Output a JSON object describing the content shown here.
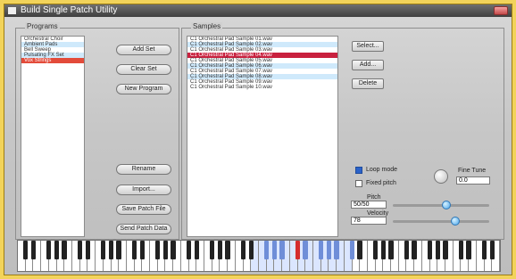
{
  "window": {
    "title": "Build Single Patch Utility"
  },
  "programs": {
    "label": "Programs",
    "items": [
      {
        "label": "Orchestral Choir",
        "style": "normal"
      },
      {
        "label": "Ambient Pads",
        "style": "alt"
      },
      {
        "label": "Bell Sweep",
        "style": "normal"
      },
      {
        "label": "Pulsating FX Set",
        "style": "alt"
      },
      {
        "label": "Vox Strings",
        "style": "sel"
      }
    ]
  },
  "program_buttons": {
    "add_set": "Add Set",
    "clear_set": "Clear Set",
    "new_program": "New Program",
    "rename": "Rename",
    "import": "Import...",
    "save_patch_file": "Save Patch File",
    "send_patch_data": "Send Patch Data"
  },
  "samples": {
    "label": "Samples",
    "items": [
      {
        "label": "C1 Orchestral Pad Sample 01.wav",
        "style": "normal"
      },
      {
        "label": "C1 Orchestral Pad Sample 02.wav",
        "style": "alt"
      },
      {
        "label": "C1 Orchestral Pad Sample 03.wav",
        "style": "normal"
      },
      {
        "label": "C1 Orchestral Pad Sample 04.wav",
        "style": "selhi"
      },
      {
        "label": "C1 Orchestral Pad Sample 05.wav",
        "style": "normal"
      },
      {
        "label": "C1 Orchestral Pad Sample 06.wav",
        "style": "alt"
      },
      {
        "label": "C1 Orchestral Pad Sample 07.wav",
        "style": "normal"
      },
      {
        "label": "C1 Orchestral Pad Sample 08.wav",
        "style": "alt"
      },
      {
        "label": "C1 Orchestral Pad Sample 09.wav",
        "style": "normal"
      },
      {
        "label": "C1 Orchestral Pad Sample 10.wav",
        "style": "normal"
      }
    ]
  },
  "sample_buttons": {
    "select": "Select...",
    "add": "Add...",
    "delete": "Delete"
  },
  "options": {
    "loop_mode_label": "Loop mode",
    "fixed_pitch_label": "Fixed pitch",
    "loop_mode_checked": true,
    "fixed_pitch_checked": false,
    "fine_tune_label": "Fine Tune",
    "fine_tune_value": "0.0",
    "pitch_label": "Pitch",
    "pitch_value": "50/50",
    "velocity_label": "Velocity",
    "velocity_value": "78",
    "pitch_level": 0.56,
    "velocity_level": 0.66
  },
  "keyboard": {
    "white_keys": 62,
    "selected_white_range": [
      30,
      42
    ],
    "selected_black_range": [
      30,
      42
    ],
    "active_key": 35
  },
  "colors": {
    "background": "#f2d35a",
    "list_alt": "#cfe9fb",
    "selected_item": "#e34b3a",
    "selected_sample": "#c9213f",
    "key_selected": "#6f8ed8",
    "key_active": "#d52c2c"
  }
}
